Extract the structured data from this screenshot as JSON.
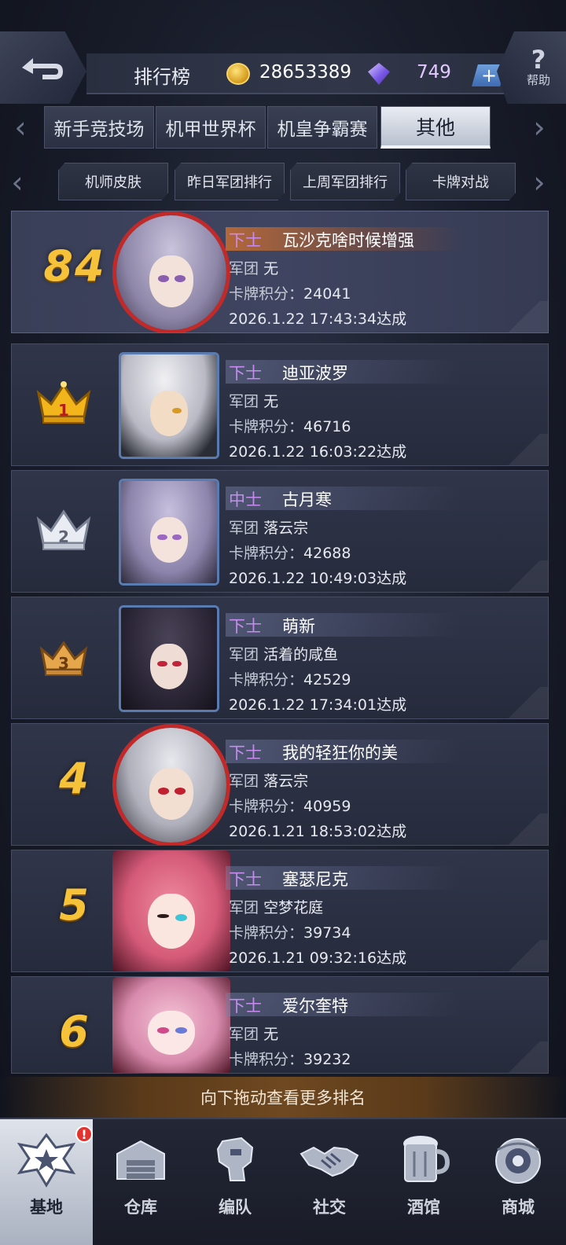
{
  "header": {
    "title": "排行榜",
    "coins": "28653389",
    "gems": "749",
    "plus": "+",
    "help_label": "帮助"
  },
  "main_tabs": [
    {
      "label": "新手竞技场",
      "active": false
    },
    {
      "label": "机甲世界杯",
      "active": false
    },
    {
      "label": "机皇争霸赛",
      "active": false
    },
    {
      "label": "其他",
      "active": true
    }
  ],
  "sub_tabs": [
    {
      "label": "机师皮肤"
    },
    {
      "label": "昨日军团排行"
    },
    {
      "label": "上周军团排行"
    },
    {
      "label": "卡牌对战"
    }
  ],
  "labels": {
    "legion": "军团",
    "score": "卡牌积分："
  },
  "my_entry": {
    "rank": "84",
    "title": "下士",
    "name": "瓦沙克啥时候增强",
    "legion": "无",
    "score": "24041",
    "time": "2026.1.22 17:43:34达成"
  },
  "entries": [
    {
      "rank": "1",
      "title": "下士",
      "name": "迪亚波罗",
      "legion": "无",
      "score": "46716",
      "time": "2026.1.22 16:03:22达成"
    },
    {
      "rank": "2",
      "title": "中士",
      "name": "古月寒",
      "legion": "落云宗",
      "score": "42688",
      "time": "2026.1.22 10:49:03达成"
    },
    {
      "rank": "3",
      "title": "下士",
      "name": "萌新",
      "legion": "活着的咸鱼",
      "score": "42529",
      "time": "2026.1.22 17:34:01达成"
    },
    {
      "rank": "4",
      "title": "下士",
      "name": "我的轻狂你的美",
      "legion": "落云宗",
      "score": "40959",
      "time": "2026.1.21 18:53:02达成"
    },
    {
      "rank": "5",
      "title": "下士",
      "name": "塞瑟尼克",
      "legion": "空梦花庭",
      "score": "39734",
      "time": "2026.1.21 09:32:16达成"
    },
    {
      "rank": "6",
      "title": "下士",
      "name": "爱尔奎特",
      "legion": "无",
      "score": "39232",
      "time": ""
    }
  ],
  "hint": "向下拖动查看更多排名",
  "nav": [
    {
      "label": "基地",
      "icon": "base-emblem-icon",
      "active": true,
      "badge": "!"
    },
    {
      "label": "仓库",
      "icon": "warehouse-icon",
      "active": false
    },
    {
      "label": "编队",
      "icon": "mech-team-icon",
      "active": false
    },
    {
      "label": "社交",
      "icon": "handshake-icon",
      "active": false
    },
    {
      "label": "酒馆",
      "icon": "beer-mug-icon",
      "active": false
    },
    {
      "label": "商城",
      "icon": "shop-orb-icon",
      "active": false
    }
  ],
  "colors": {
    "rank_gold": "#f6c23a",
    "title_purple": "#c88cf0",
    "title_sergeant_purple": "#c77cf2",
    "mine_highlight": "#c86e32",
    "crown_gold": "#f2b61c",
    "crown_silver": "#e9ecf2",
    "crown_bronze": "#e6a64c"
  }
}
